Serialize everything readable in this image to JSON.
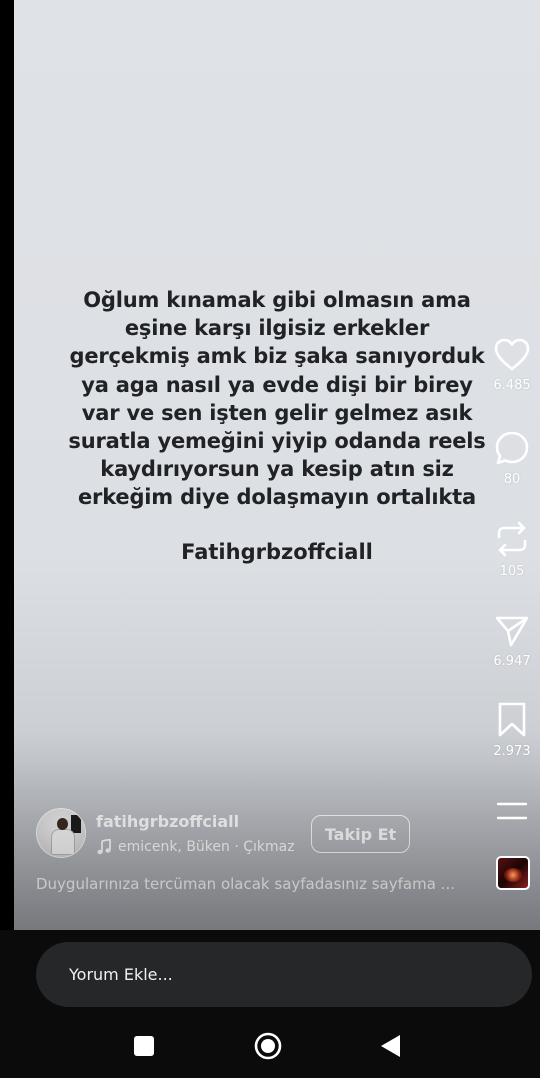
{
  "post": {
    "lines": [
      "Oğlum kınamak gibi olmasın ama",
      "eşine karşı ilgisiz erkekler",
      "gerçekmiş amk biz şaka sanıyorduk",
      "ya aga nasıl ya evde dişi bir birey",
      "var ve sen işten gelir gelmez asık",
      "suratla yemeğini yiyip odanda reels",
      "kaydırıyorsun ya kesip atın siz",
      "erkeğim diye dolaşmayın ortalıkta"
    ],
    "signature": "Fatihgrbzoffciall"
  },
  "actions": {
    "like": {
      "icon": "heart-icon",
      "count": "6.485"
    },
    "comment": {
      "icon": "comment-bubble-icon",
      "count": "80"
    },
    "repost": {
      "icon": "repost-icon",
      "count": "105"
    },
    "share": {
      "icon": "send-icon",
      "count": "6.947"
    },
    "save": {
      "icon": "bookmark-icon",
      "count": "2.973"
    },
    "more": {
      "icon": "menu-icon"
    }
  },
  "author": {
    "username": "fatihgrbzoffciall",
    "music": "emicenk, Büken · Çıkmaz E",
    "follow_label": "Takip Et"
  },
  "caption": "Duygularınıza tercüman olacak sayfadasınız sayfama ...",
  "comment_input": {
    "placeholder": "Yorum Ekle..."
  },
  "nav": {
    "icons": [
      "recents-square-icon",
      "home-circle-icon",
      "back-triangle-icon"
    ]
  },
  "colors": {
    "text_dark": "#202226",
    "background": "#dfe2e6",
    "bar": "#0b0b0c",
    "input": "#262729"
  }
}
